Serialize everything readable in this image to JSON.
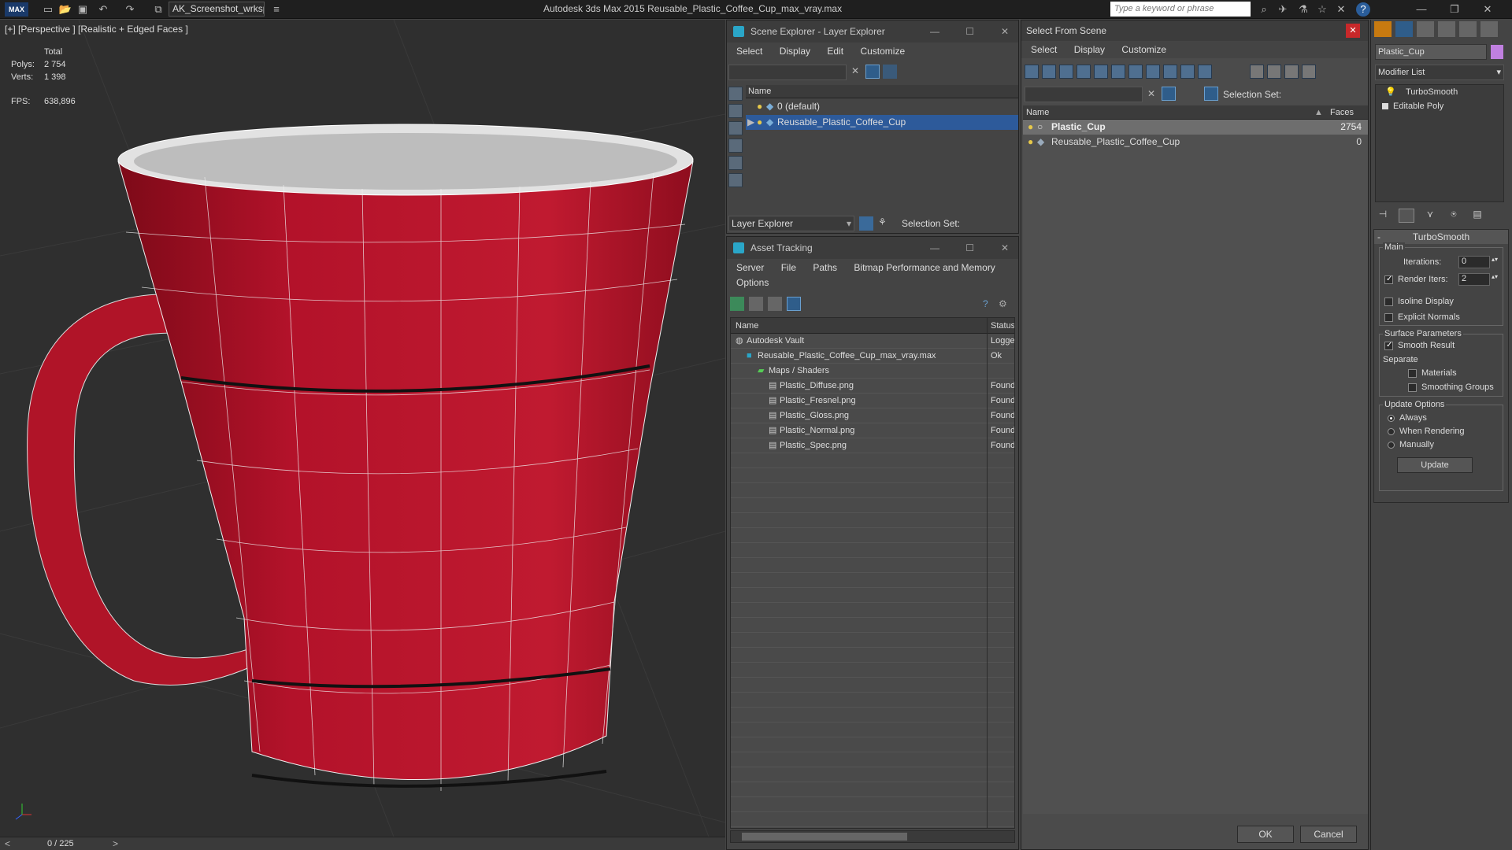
{
  "app": {
    "logo": "MAX",
    "workspace": "AK_Screenshot_wrksp",
    "title": "Autodesk 3ds Max  2015     Reusable_Plastic_Coffee_Cup_max_vray.max",
    "search_placeholder": "Type a keyword or phrase"
  },
  "viewport": {
    "label": "[+] [Perspective ] [Realistic + Edged Faces ]",
    "total_label": "Total",
    "polys_label": "Polys:",
    "polys_value": "2 754",
    "verts_label": "Verts:",
    "verts_value": "1 398",
    "fps_label": "FPS:",
    "fps_value": "638,896"
  },
  "timeline": {
    "frame": "0 / 225"
  },
  "scene_explorer": {
    "title": "Scene Explorer - Layer Explorer",
    "menu": [
      "Select",
      "Display",
      "Edit",
      "Customize"
    ],
    "col_name": "Name",
    "layers": [
      "0 (default)",
      "Reusable_Plastic_Coffee_Cup"
    ],
    "footer_dropdown": "Layer Explorer",
    "selection_set_label": "Selection Set:"
  },
  "asset_tracking": {
    "title": "Asset Tracking",
    "menu": [
      "Server",
      "File",
      "Paths",
      "Bitmap Performance and Memory"
    ],
    "menu2": "Options",
    "col_name": "Name",
    "col_status": "Status",
    "rows": [
      {
        "name": "Autodesk Vault",
        "status": "Logge"
      },
      {
        "name": "Reusable_Plastic_Coffee_Cup_max_vray.max",
        "status": "Ok"
      },
      {
        "name": "Maps / Shaders",
        "status": ""
      },
      {
        "name": "Plastic_Diffuse.png",
        "status": "Found"
      },
      {
        "name": "Plastic_Fresnel.png",
        "status": "Found"
      },
      {
        "name": "Plastic_Gloss.png",
        "status": "Found"
      },
      {
        "name": "Plastic_Normal.png",
        "status": "Found"
      },
      {
        "name": "Plastic_Spec.png",
        "status": "Found"
      }
    ]
  },
  "select_from_scene": {
    "title": "Select From Scene",
    "menu": [
      "Select",
      "Display",
      "Customize"
    ],
    "selection_set_label": "Selection Set:",
    "col_name": "Name",
    "col_faces": "Faces",
    "rows": [
      {
        "name": "Plastic_Cup",
        "faces": "2754"
      },
      {
        "name": "Reusable_Plastic_Coffee_Cup",
        "faces": "0"
      }
    ],
    "ok": "OK",
    "cancel": "Cancel"
  },
  "modify_panel": {
    "object_name": "Plastic_Cup",
    "modifier_list": "Modifier List",
    "stack": [
      "TurboSmooth",
      "Editable Poly"
    ],
    "rollout_title": "TurboSmooth",
    "main_label": "Main",
    "iterations_label": "Iterations:",
    "iterations_value": "0",
    "render_iters_label": "Render Iters:",
    "render_iters_value": "2",
    "isoline": "Isoline Display",
    "explicit_normals": "Explicit Normals",
    "surface_params": "Surface Parameters",
    "smooth_result": "Smooth Result",
    "separate": "Separate",
    "materials": "Materials",
    "smoothing_groups": "Smoothing Groups",
    "update_options": "Update Options",
    "always": "Always",
    "when_rendering": "When Rendering",
    "manually": "Manually",
    "update_btn": "Update"
  }
}
